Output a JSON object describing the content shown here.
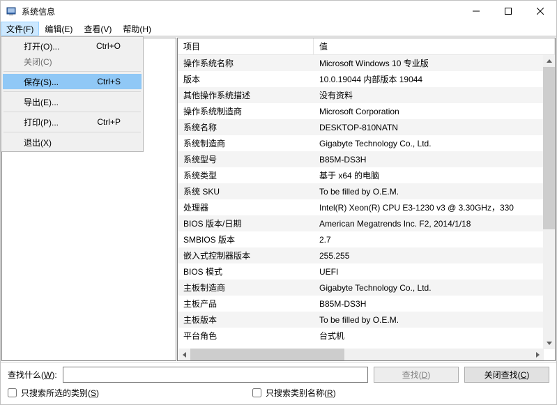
{
  "window": {
    "title": "系统信息"
  },
  "menu": {
    "file": "文件(F)",
    "edit": "编辑(E)",
    "view": "查看(V)",
    "help": "帮助(H)"
  },
  "fileMenu": {
    "open": {
      "label": "打开(O)...",
      "shortcut": "Ctrl+O"
    },
    "close": {
      "label": "关闭(C)",
      "shortcut": ""
    },
    "save": {
      "label": "保存(S)...",
      "shortcut": "Ctrl+S"
    },
    "export": {
      "label": "导出(E)...",
      "shortcut": ""
    },
    "print": {
      "label": "打印(P)...",
      "shortcut": "Ctrl+P"
    },
    "exit": {
      "label": "退出(X)",
      "shortcut": ""
    }
  },
  "columns": {
    "item": "项目",
    "value": "值"
  },
  "rows": [
    {
      "k": "操作系统名称",
      "v": "Microsoft Windows 10 专业版"
    },
    {
      "k": "版本",
      "v": "10.0.19044 内部版本 19044"
    },
    {
      "k": "其他操作系统描述",
      "v": "没有资料"
    },
    {
      "k": "操作系统制造商",
      "v": "Microsoft Corporation"
    },
    {
      "k": "系统名称",
      "v": "DESKTOP-810NATN"
    },
    {
      "k": "系统制造商",
      "v": "Gigabyte Technology Co., Ltd."
    },
    {
      "k": "系统型号",
      "v": "B85M-DS3H"
    },
    {
      "k": "系统类型",
      "v": "基于 x64 的电脑"
    },
    {
      "k": "系统 SKU",
      "v": "To be filled by O.E.M."
    },
    {
      "k": "处理器",
      "v": "Intel(R) Xeon(R) CPU E3-1230 v3 @ 3.30GHz，330"
    },
    {
      "k": "BIOS 版本/日期",
      "v": "American Megatrends Inc. F2, 2014/1/18"
    },
    {
      "k": "SMBIOS 版本",
      "v": "2.7"
    },
    {
      "k": "嵌入式控制器版本",
      "v": "255.255"
    },
    {
      "k": "BIOS 模式",
      "v": "UEFI"
    },
    {
      "k": "主板制造商",
      "v": "Gigabyte Technology Co., Ltd."
    },
    {
      "k": "主板产品",
      "v": "B85M-DS3H"
    },
    {
      "k": "主板版本",
      "v": "To be filled by O.E.M."
    },
    {
      "k": "平台角色",
      "v": "台式机"
    }
  ],
  "search": {
    "label_pre": "查找什么(",
    "label_u": "W",
    "label_post": "):",
    "find_pre": "查找(",
    "find_u": "D",
    "find_post": ")",
    "close_pre": "关闭查找(",
    "close_u": "C",
    "close_post": ")",
    "only_sel_pre": "只搜索所选的类别(",
    "only_sel_u": "S",
    "only_sel_post": ")",
    "only_cat_pre": "只搜索类别名称(",
    "only_cat_u": "R",
    "only_cat_post": ")"
  }
}
